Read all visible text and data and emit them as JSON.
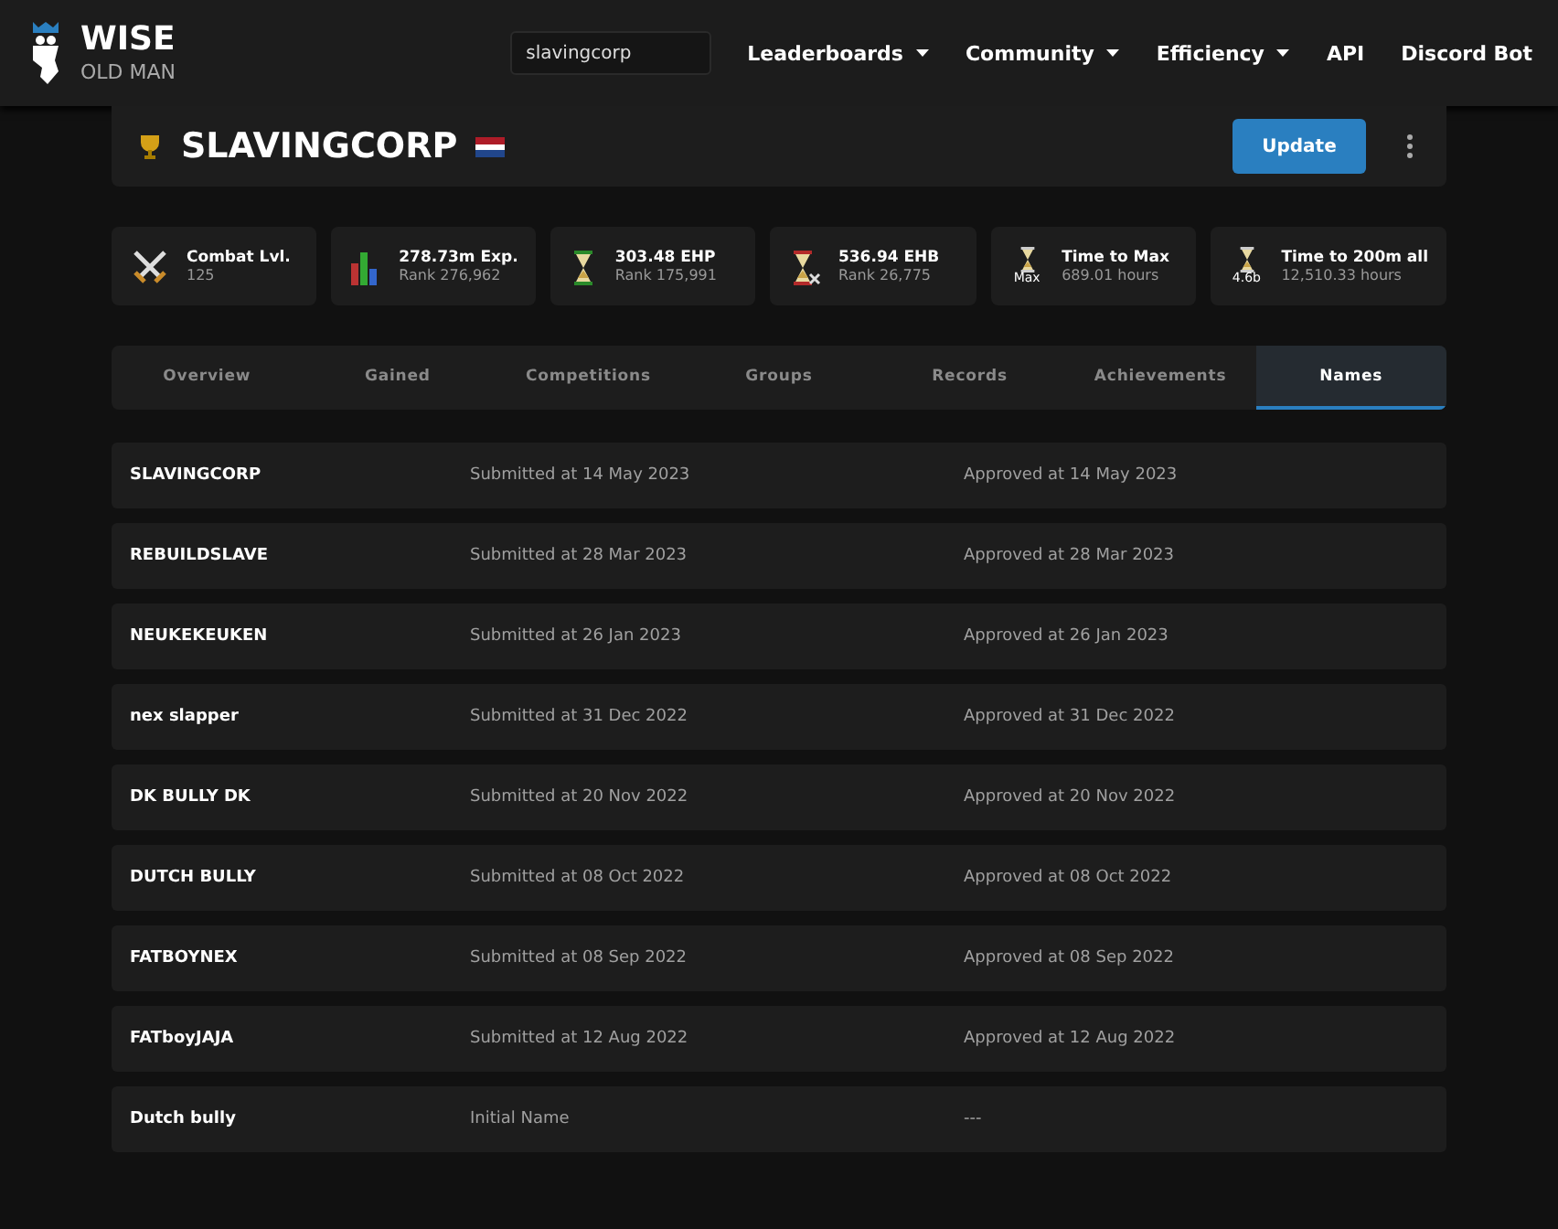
{
  "nav": {
    "logo_title": "WISE",
    "logo_subtitle": "OLD MAN",
    "search_value": "slavingcorp",
    "links": [
      {
        "label": "Leaderboards",
        "dropdown": true
      },
      {
        "label": "Community",
        "dropdown": true
      },
      {
        "label": "Efficiency",
        "dropdown": true
      },
      {
        "label": "API",
        "dropdown": false
      },
      {
        "label": "Discord Bot",
        "dropdown": false
      }
    ]
  },
  "player": {
    "name": "SLAVINGCORP",
    "update_button": "Update"
  },
  "stats": [
    {
      "kind": "combat",
      "title": "Combat Lvl.",
      "sub": "125"
    },
    {
      "kind": "exp",
      "title": "278.73m Exp.",
      "sub": "Rank 276,962"
    },
    {
      "kind": "ehp",
      "title": "303.48 EHP",
      "sub": "Rank 175,991"
    },
    {
      "kind": "ehb",
      "title": "536.94 EHB",
      "sub": "Rank 26,775"
    },
    {
      "kind": "max",
      "title": "Time to Max",
      "sub": "689.01 hours",
      "icon_text": "Max"
    },
    {
      "kind": "max",
      "title": "Time to 200m all",
      "sub": "12,510.33 hours",
      "icon_text": "4.6b"
    }
  ],
  "tabs": [
    {
      "label": "Overview",
      "selected": false
    },
    {
      "label": "Gained",
      "selected": false
    },
    {
      "label": "Competitions",
      "selected": false
    },
    {
      "label": "Groups",
      "selected": false
    },
    {
      "label": "Records",
      "selected": false
    },
    {
      "label": "Achievements",
      "selected": false
    },
    {
      "label": "Names",
      "selected": true
    }
  ],
  "names": [
    {
      "name": "SLAVINGCORP",
      "submitted": "Submitted at 14 May 2023",
      "approved": "Approved at 14 May 2023"
    },
    {
      "name": "REBUILDSLAVE",
      "submitted": "Submitted at 28 Mar 2023",
      "approved": "Approved at 28 Mar 2023"
    },
    {
      "name": "NEUKEKEUKEN",
      "submitted": "Submitted at 26 Jan 2023",
      "approved": "Approved at 26 Jan 2023"
    },
    {
      "name": "nex slapper",
      "submitted": "Submitted at 31 Dec 2022",
      "approved": "Approved at 31 Dec 2022"
    },
    {
      "name": "DK BULLY DK",
      "submitted": "Submitted at 20 Nov 2022",
      "approved": "Approved at 20 Nov 2022"
    },
    {
      "name": "DUTCH BULLY",
      "submitted": "Submitted at 08 Oct 2022",
      "approved": "Approved at 08 Oct 2022"
    },
    {
      "name": "FATBOYNEX",
      "submitted": "Submitted at 08 Sep 2022",
      "approved": "Approved at 08 Sep 2022"
    },
    {
      "name": "FATboyJAJA",
      "submitted": "Submitted at 12 Aug 2022",
      "approved": "Approved at 12 Aug 2022"
    },
    {
      "name": "Dutch bully",
      "submitted": "Initial Name",
      "approved": "---"
    }
  ]
}
